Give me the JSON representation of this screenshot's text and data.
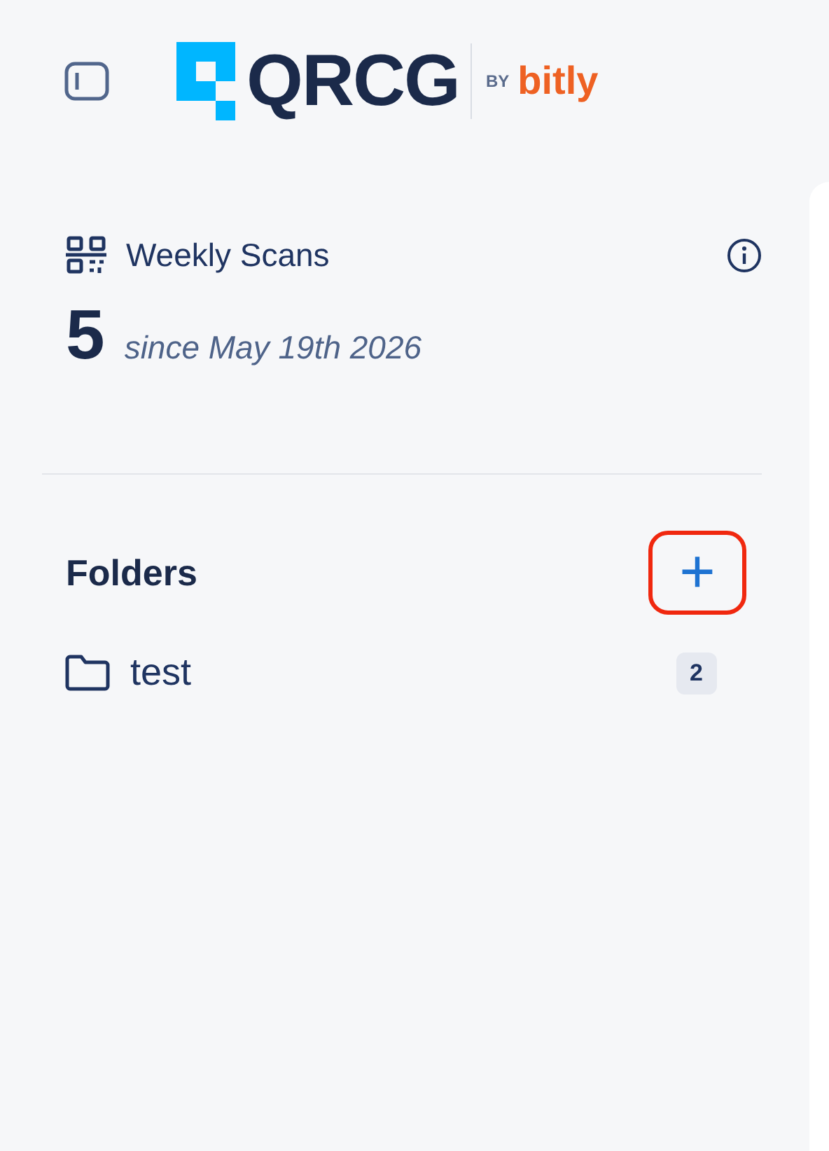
{
  "logo": {
    "name": "QRCG",
    "by": "BY",
    "partner": "bitly"
  },
  "weekly_scans": {
    "title": "Weekly Scans",
    "count": "5",
    "since": "since May 19th 2026"
  },
  "folders": {
    "title": "Folders",
    "add_button": {
      "label": "+",
      "highlighted": true
    },
    "items": [
      {
        "name": "test",
        "count": "2",
        "selected": false
      }
    ]
  }
}
